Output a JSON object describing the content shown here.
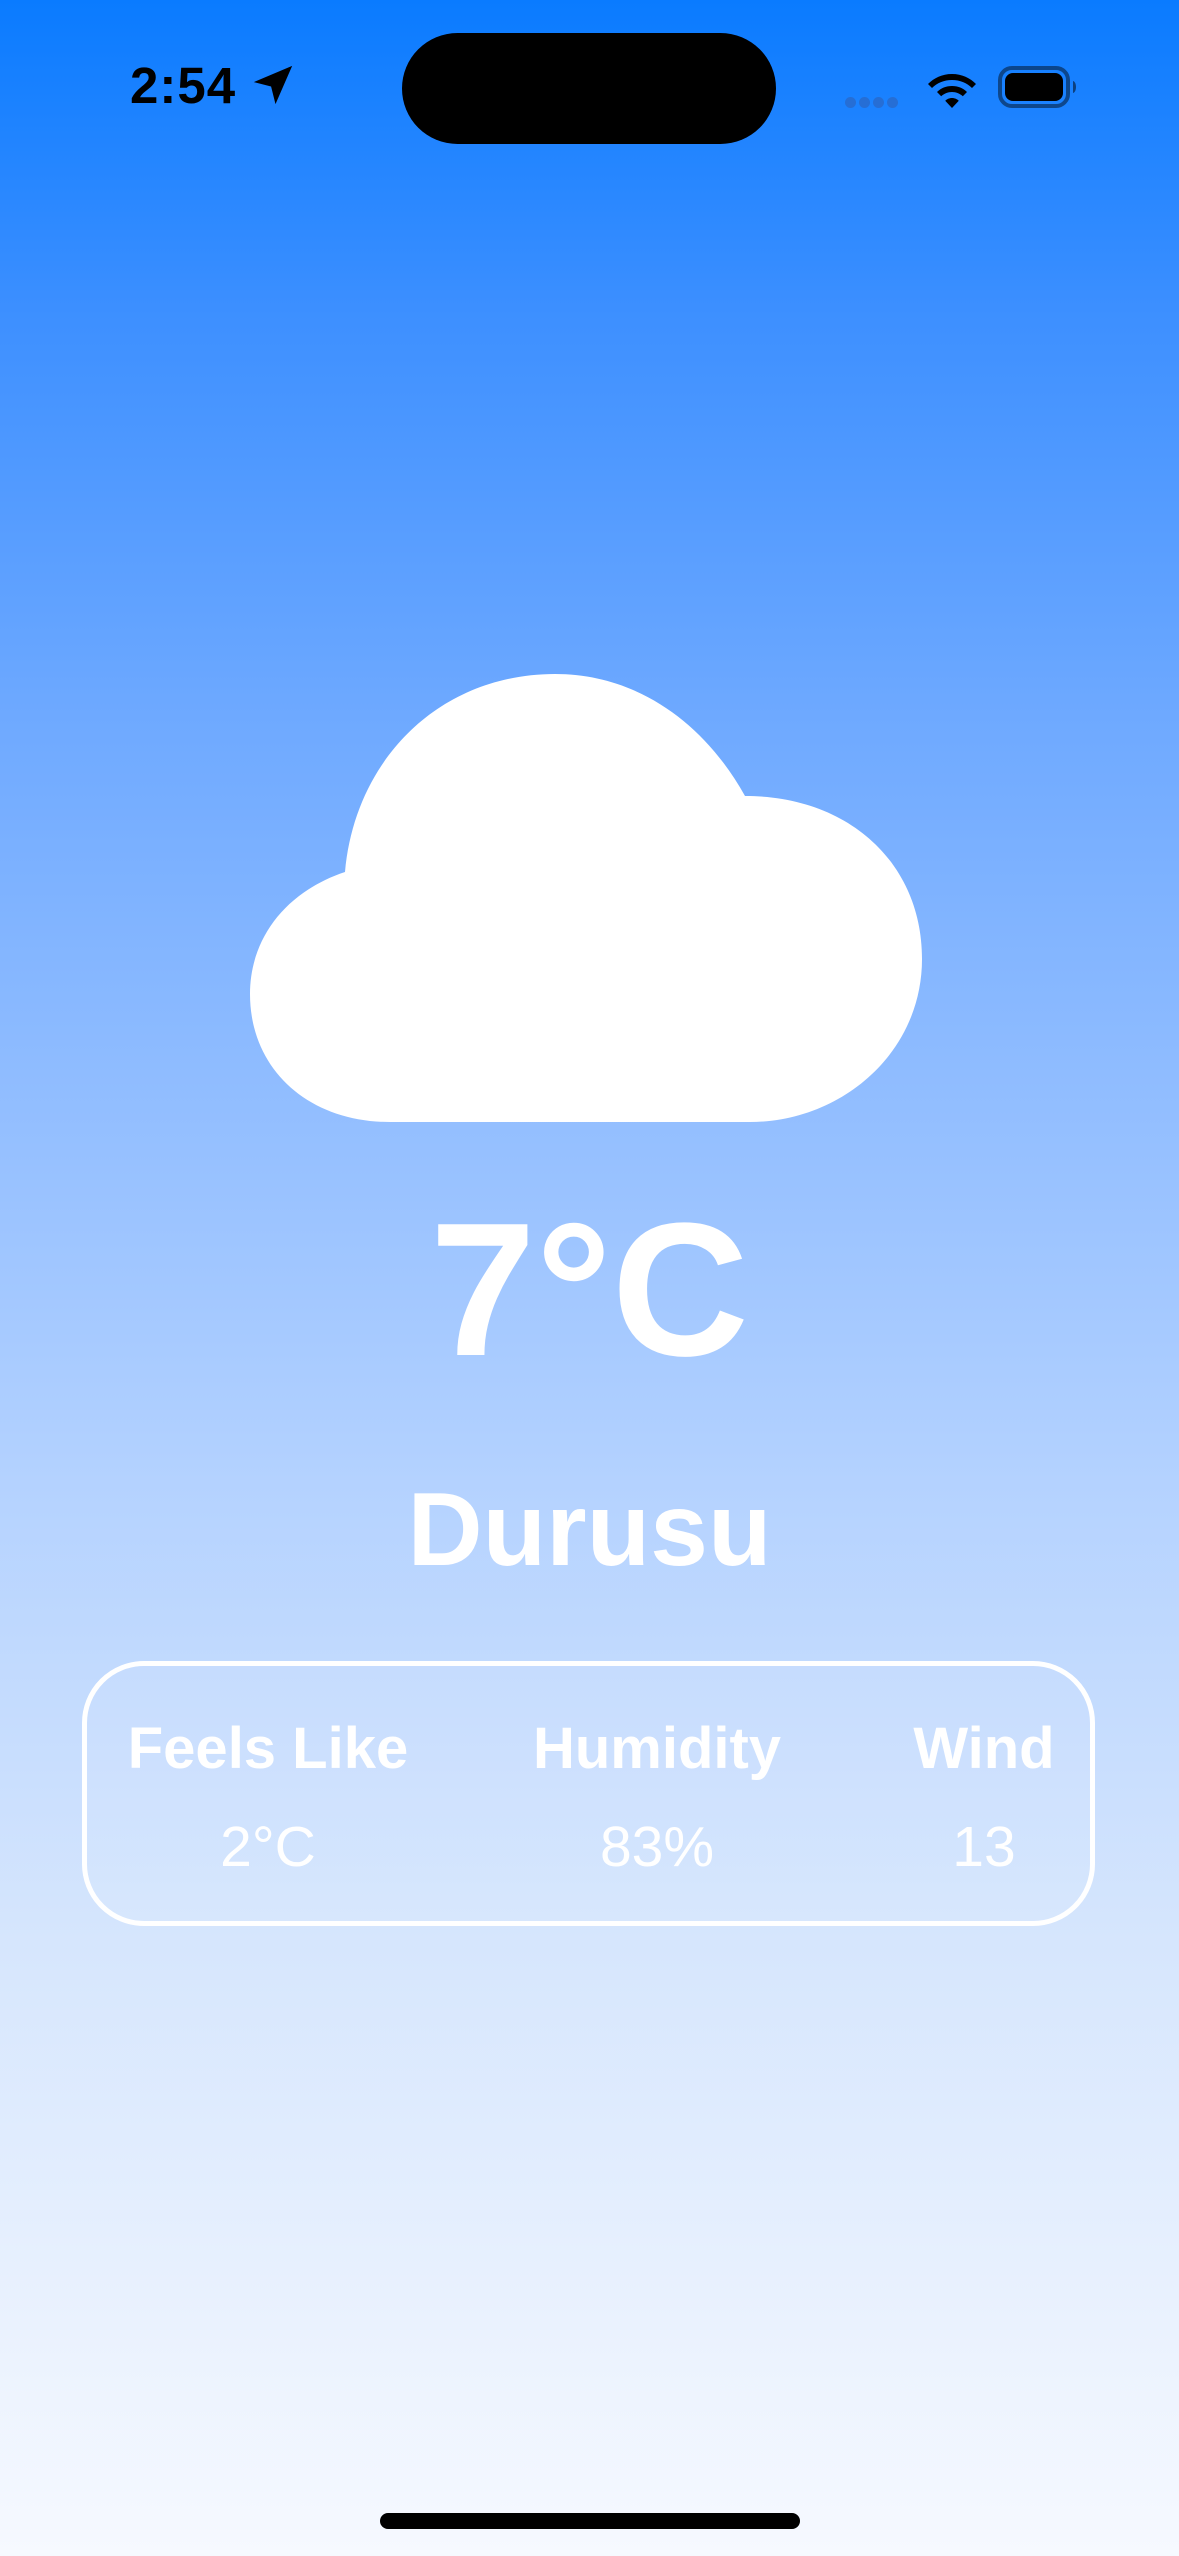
{
  "status_bar": {
    "time": "2:54",
    "location_icon": "location-arrow-icon",
    "wifi_icon": "wifi-icon",
    "battery_icon": "battery-icon",
    "cellular_icon": "cellular-signal-icon"
  },
  "weather": {
    "condition_icon": "cloud-icon",
    "temperature": "7°C",
    "city": "Durusu"
  },
  "details": [
    {
      "label": "Feels Like",
      "value": "2°C"
    },
    {
      "label": "Humidity",
      "value": "83%"
    },
    {
      "label": "Wind",
      "value": "13"
    }
  ],
  "colors": {
    "gradient_top": "#0a7bff",
    "gradient_bottom": "#f6f9ff",
    "text": "#ffffff",
    "card_border": "#ffffff"
  }
}
